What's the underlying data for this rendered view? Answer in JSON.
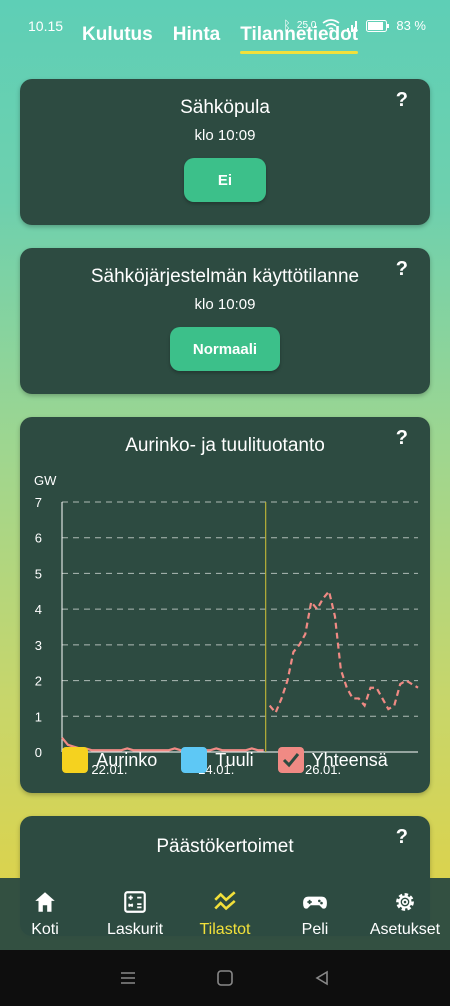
{
  "status": {
    "time": "10.15",
    "net": "25.0",
    "battery": "83 %"
  },
  "tabs": [
    "Kulutus",
    "Hinta",
    "Tilannetiedot"
  ],
  "cards": {
    "peak": {
      "title": "Sähköpula",
      "time": "klo 10:09",
      "button": "Ei",
      "help": "?"
    },
    "system": {
      "title": "Sähköjärjestelmän käyttötilanne",
      "time": "klo 10:09",
      "button": "Normaali",
      "help": "?"
    },
    "production": {
      "title": "Aurinko- ja tuulituotanto",
      "help": "?"
    },
    "emissions": {
      "title": "Päästökertoimet",
      "help": "?"
    }
  },
  "chart_data": {
    "type": "line",
    "title": "Aurinko- ja tuulituotanto",
    "ylabel": "GW",
    "ylim": [
      0,
      7
    ],
    "yticks": [
      "0",
      "1",
      "2",
      "3",
      "4",
      "5",
      "6",
      "7"
    ],
    "xticks": [
      "22.01.",
      "24.01.",
      "26.01."
    ],
    "grid": true,
    "legend": [
      "Aurinko",
      "Tuuli",
      "Yhteensä"
    ],
    "colors": {
      "Aurinko": "#f5d21f",
      "Tuuli": "#5ec8f5",
      "Yhteensä": "#f08a84",
      "divider": "#b8b038"
    },
    "x": [
      0,
      0.25,
      0.5,
      0.75,
      1,
      1.25,
      1.5,
      1.75,
      2,
      2.25,
      2.5,
      2.75,
      3,
      3.25,
      3.5,
      3.75,
      4,
      4.25,
      4.5,
      4.75,
      5,
      5.25,
      5.5,
      5.75,
      6,
      6.25,
      6.5,
      6.75,
      7,
      7.25,
      7.5,
      7.75,
      8,
      8.25,
      8.5,
      8.75,
      9,
      9.25,
      9.5,
      9.75,
      10,
      10.25,
      10.5,
      10.75,
      11,
      11.25,
      11.5,
      11.75,
      12,
      12.25,
      12.5,
      12.75,
      13,
      13.25,
      13.5,
      13.75,
      14,
      14.25,
      14.5,
      14.75,
      15
    ],
    "series": [
      {
        "name": "Yhteensä",
        "values": [
          0.4,
          0.2,
          0.15,
          0.1,
          0.1,
          0.05,
          0.05,
          0.05,
          0.05,
          0.05,
          0.05,
          0.1,
          0.05,
          0.05,
          0.05,
          0.05,
          0.05,
          0.05,
          0.05,
          0.1,
          0.05,
          0.05,
          0.05,
          0.05,
          0.05,
          0.05,
          0.1,
          0.05,
          0.05,
          0.05,
          0.05,
          0.05,
          0.1,
          0.05,
          0.05,
          1.3,
          1.1,
          1.5,
          2.0,
          2.8,
          3.0,
          3.3,
          4.2,
          4.0,
          4.3,
          4.5,
          3.8,
          2.3,
          1.8,
          1.5,
          1.5,
          1.3,
          1.8,
          1.8,
          1.5,
          1.2,
          1.3,
          1.9,
          2.0,
          1.9,
          1.8
        ]
      }
    ],
    "now_index": 35
  },
  "nav": [
    {
      "label": "Koti",
      "icon": "home-icon"
    },
    {
      "label": "Laskurit",
      "icon": "calculator-icon"
    },
    {
      "label": "Tilastot",
      "icon": "stats-icon"
    },
    {
      "label": "Peli",
      "icon": "gamepad-icon"
    },
    {
      "label": "Asetukset",
      "icon": "gear-icon"
    }
  ],
  "active_nav": 2
}
